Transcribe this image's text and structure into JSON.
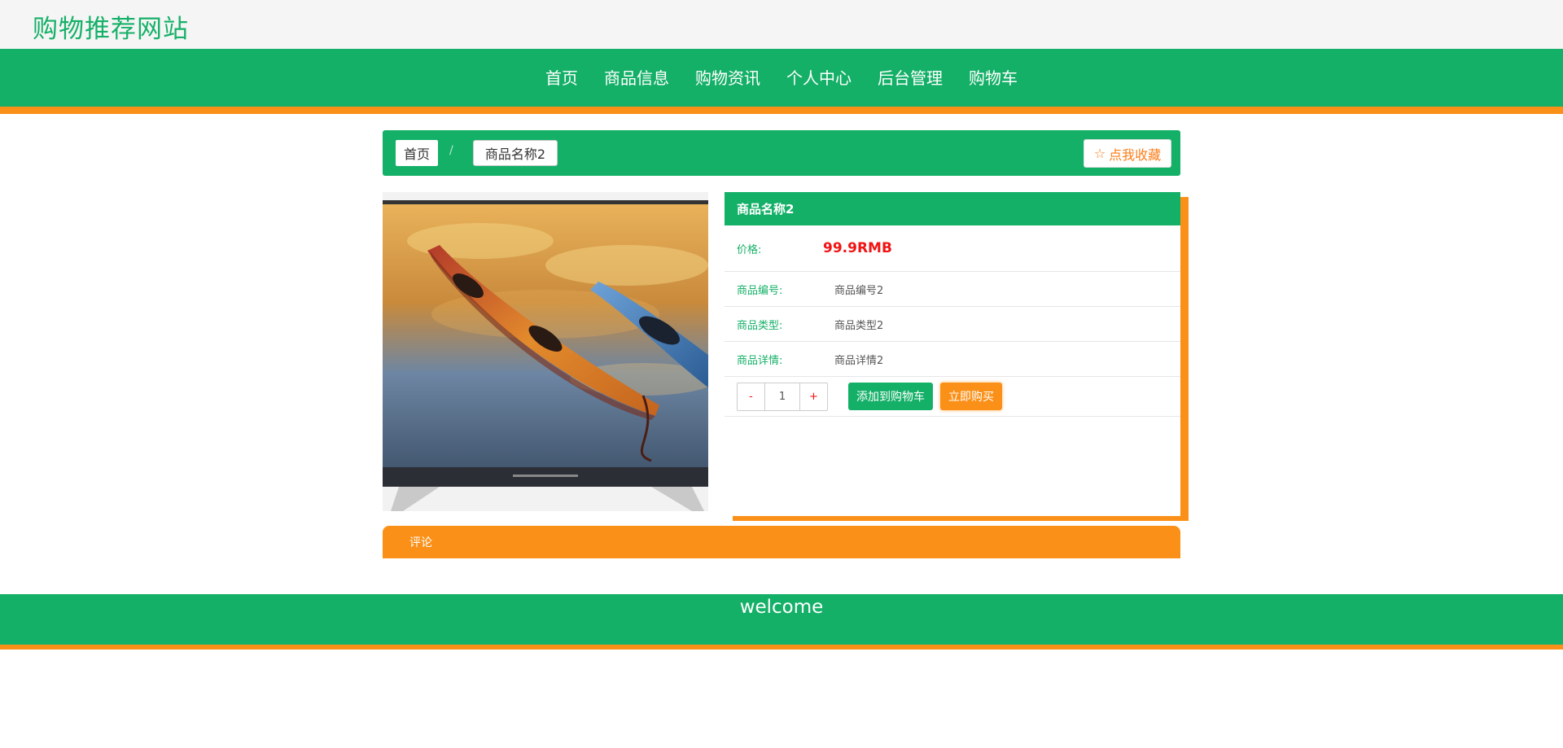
{
  "site": {
    "title": "购物推荐网站"
  },
  "nav": {
    "items": [
      {
        "label": "首页"
      },
      {
        "label": "商品信息"
      },
      {
        "label": "购物资讯"
      },
      {
        "label": "个人中心"
      },
      {
        "label": "后台管理"
      },
      {
        "label": "购物车"
      }
    ]
  },
  "breadcrumb": {
    "home": "首页",
    "separator": "/",
    "current": "商品名称2",
    "favorite_label": "点我收藏"
  },
  "product": {
    "name": "商品名称2",
    "price_label": "价格:",
    "price": "99.9RMB",
    "fields": [
      {
        "label": "商品编号:",
        "value": "商品编号2"
      },
      {
        "label": "商品类型:",
        "value": "商品类型2"
      },
      {
        "label": "商品详情:",
        "value": "商品详情2"
      }
    ],
    "quantity": "1",
    "minus_label": "-",
    "plus_label": "+",
    "add_to_cart": "添加到购物车",
    "buy_now": "立即购买"
  },
  "comments": {
    "label": "评论"
  },
  "footer": {
    "text": "welcome"
  },
  "colors": {
    "primary": "#15b068",
    "accent": "#fb9018",
    "price": "#f01414"
  },
  "icons": {
    "favorite": "star-outline-icon"
  }
}
